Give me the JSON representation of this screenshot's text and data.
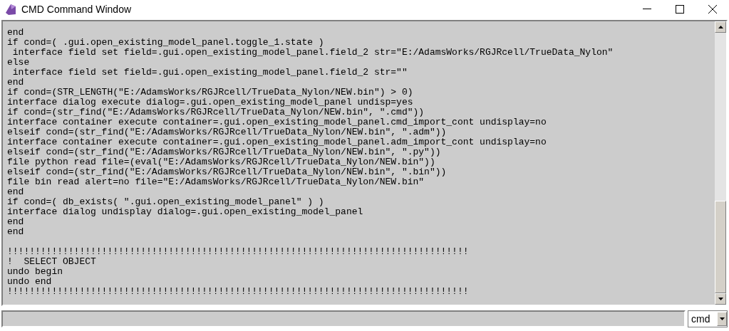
{
  "window": {
    "title": "CMD Command Window"
  },
  "log_lines": [
    "end",
    "if cond=( .gui.open_existing_model_panel.toggle_1.state )",
    " interface field set field=.gui.open_existing_model_panel.field_2 str=\"E:/AdamsWorks/RGJRcell/TrueData_Nylon\"",
    "else",
    " interface field set field=.gui.open_existing_model_panel.field_2 str=\"\"",
    "end",
    "if cond=(STR_LENGTH(\"E:/AdamsWorks/RGJRcell/TrueData_Nylon/NEW.bin\") > 0)",
    "interface dialog execute dialog=.gui.open_existing_model_panel undisp=yes",
    "if cond=(str_find(\"E:/AdamsWorks/RGJRcell/TrueData_Nylon/NEW.bin\", \".cmd\"))",
    "interface container execute container=.gui.open_existing_model_panel.cmd_import_cont undisplay=no",
    "elseif cond=(str_find(\"E:/AdamsWorks/RGJRcell/TrueData_Nylon/NEW.bin\", \".adm\"))",
    "interface container execute container=.gui.open_existing_model_panel.adm_import_cont undisplay=no",
    "elseif cond=(str_find(\"E:/AdamsWorks/RGJRcell/TrueData_Nylon/NEW.bin\", \".py\"))",
    "file python read file=(eval(\"E:/AdamsWorks/RGJRcell/TrueData_Nylon/NEW.bin\"))",
    "elseif cond=(str_find(\"E:/AdamsWorks/RGJRcell/TrueData_Nylon/NEW.bin\", \".bin\"))",
    "file bin read alert=no file=\"E:/AdamsWorks/RGJRcell/TrueData_Nylon/NEW.bin\"",
    "end",
    "if cond=( db_exists( \".gui.open_existing_model_panel\" ) )",
    "interface dialog undisplay dialog=.gui.open_existing_model_panel",
    "end",
    "end"
  ],
  "log_lines_after_gap": [
    "!!!!!!!!!!!!!!!!!!!!!!!!!!!!!!!!!!!!!!!!!!!!!!!!!!!!!!!!!!!!!!!!!!!!!!!!!!!!!!!!!!!",
    "!  SELECT OBJECT",
    "undo begin",
    "undo end",
    "!!!!!!!!!!!!!!!!!!!!!!!!!!!!!!!!!!!!!!!!!!!!!!!!!!!!!!!!!!!!!!!!!!!!!!!!!!!!!!!!!!!"
  ],
  "mode_select": {
    "value": "cmd"
  }
}
